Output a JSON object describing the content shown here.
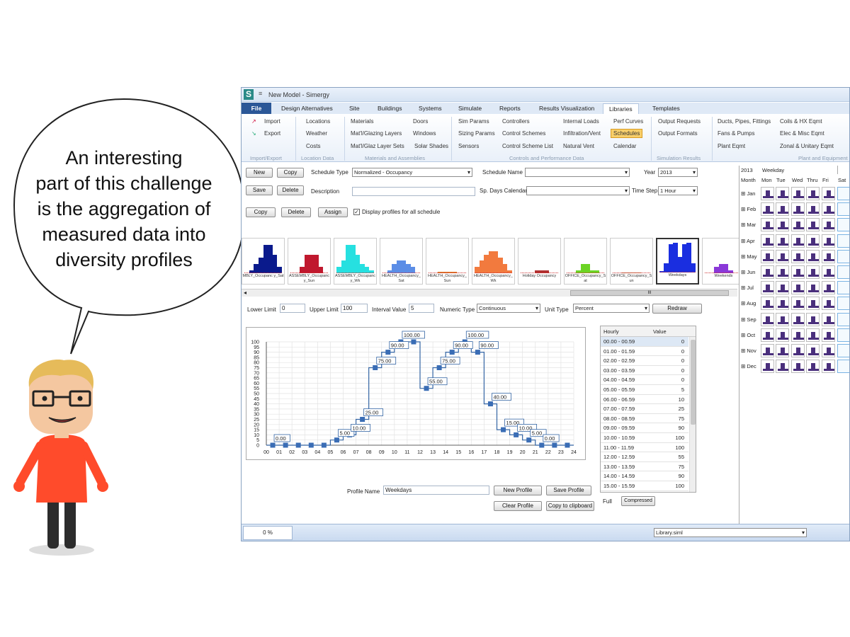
{
  "bubble_text": [
    "An interesting",
    "part of this challenge",
    "is the aggregation of",
    "measured data into",
    "diversity profiles"
  ],
  "window": {
    "title": "New Model - Simergy",
    "tabs": [
      "File",
      "Design Alternatives",
      "Site",
      "Buildings",
      "Systems",
      "Simulate",
      "Reports",
      "Results Visualization",
      "Libraries",
      "Templates"
    ],
    "active_tab": "Libraries"
  },
  "ribbon": {
    "import": "Import",
    "export": "Export",
    "locations": "Locations",
    "weather": "Weather",
    "costs": "Costs",
    "materials": "Materials",
    "doors": "Doors",
    "glazing_layers": "Mat'l/Glazing Layers",
    "windows": "Windows",
    "glaz_layer_sets": "Mat'l/Glaz Layer Sets",
    "solar_shades": "Solar Shades",
    "sim_params": "Sim Params",
    "sizing_params": "Sizing Params",
    "sensors": "Sensors",
    "controllers": "Controllers",
    "control_schemes": "Control Schemes",
    "control_scheme_list": "Control Scheme List",
    "internal_loads": "Internal Loads",
    "infiltration_vent": "Infiltration/Vent",
    "natural_vent": "Natural Vent",
    "perf_curves": "Perf Curves",
    "schedules": "Schedules",
    "calendar": "Calendar",
    "output_requests": "Output Requests",
    "output_formats": "Output Formats",
    "ducts": "Ducts, Pipes, Fittings",
    "fans_pumps": "Fans & Pumps",
    "plant_eqmt": "Plant Eqmt",
    "coils": "Coils & HX Eqmt",
    "elec_misc": "Elec & Misc Eqmt",
    "zonal_unitary": "Zonal & Unitary Eqmt",
    "group_import_export": "Import/Export",
    "group_location": "Location Data",
    "group_materials": "Materials and Assemblies",
    "group_controls": "Controls and Performance Data",
    "group_sim_results": "Simulation Results",
    "group_plant": "Plant and Equipment"
  },
  "form": {
    "new": "New",
    "copy": "Copy",
    "save": "Save",
    "delete": "Delete",
    "schedule_type_label": "Schedule Type",
    "schedule_type": "Normalized - Occupancy",
    "schedule_name_label": "Schedule Name",
    "year_label": "Year",
    "year": "2013",
    "description_label": "Description",
    "sp_days_label": "Sp. Days Calendar",
    "time_step_label": "Time Step",
    "time_step": "1 Hour",
    "copy2": "Copy",
    "delete2": "Delete",
    "assign": "Assign",
    "display_all": "Display profiles for all schedule"
  },
  "thumbnails": [
    {
      "label": "MBLY_Occupanc y_Sat",
      "color": "#0a1a8c"
    },
    {
      "label": "ASSEMBLY_Occupanc y_Sun",
      "color": "#c0182e"
    },
    {
      "label": "ASSEMBLY_Occupanc y_Wk",
      "color": "#26e0e0"
    },
    {
      "label": "HEALTH_Occupancy_ Sat",
      "color": "#5b8de6"
    },
    {
      "label": "HEALTH_Occupancy_ Sun",
      "color": "#e07c2a"
    },
    {
      "label": "HEALTH_Occupancy_ Wk",
      "color": "#f27a3e"
    },
    {
      "label": "Holiday Occupancy",
      "color": "#b03030"
    },
    {
      "label": "OFFICE_Occupancy_S at",
      "color": "#6cd424"
    },
    {
      "label": "OFFICE_Occupancy_S un",
      "color": "#c07840"
    },
    {
      "label": "Weekdays",
      "color": "#1a2ee0"
    },
    {
      "label": "Weekends",
      "color": "#8a38d8"
    }
  ],
  "hscroll_label": "III",
  "limits": {
    "lower_label": "Lower Limit",
    "lower": "0",
    "upper_label": "Upper Limit",
    "upper": "100",
    "interval_label": "Interval Value",
    "interval": "5",
    "numeric_type_label": "Numeric Type",
    "numeric_type": "Continuous",
    "unit_type_label": "Unit Type",
    "unit_type": "Percent",
    "redraw": "Redraw"
  },
  "chart_data": {
    "type": "line",
    "x": [
      "00",
      "01",
      "02",
      "03",
      "04",
      "05",
      "06",
      "07",
      "08",
      "09",
      "10",
      "11",
      "12",
      "13",
      "14",
      "15",
      "16",
      "17",
      "18",
      "19",
      "20",
      "21",
      "22",
      "23",
      "24"
    ],
    "values": [
      0,
      0,
      0,
      0,
      0,
      5,
      10,
      25,
      75,
      90,
      100,
      100,
      55,
      75,
      90,
      100,
      90,
      40,
      15,
      10,
      5,
      0,
      0,
      0
    ],
    "labels": [
      "0.00",
      "5.00",
      "10.00",
      "25.00",
      "75.00",
      "90.00",
      "100.00",
      "55.00",
      "75.00",
      "90.00",
      "100.00",
      "90.00",
      "40.00",
      "15.00",
      "10.00",
      "5.00",
      "0.00"
    ],
    "yticks": [
      "100",
      "95",
      "90",
      "85",
      "80",
      "75",
      "70",
      "65",
      "60",
      "55",
      "50",
      "45",
      "40",
      "35",
      "30",
      "25",
      "20",
      "15",
      "10",
      "5",
      "0"
    ],
    "ylim": [
      0,
      100
    ]
  },
  "table": {
    "col_hourly": "Hourly",
    "col_value": "Value",
    "rows": [
      {
        "h": "00.00 - 00.59",
        "v": "0"
      },
      {
        "h": "01.00 - 01.59",
        "v": "0"
      },
      {
        "h": "02.00 - 02.59",
        "v": "0"
      },
      {
        "h": "03.00 - 03.59",
        "v": "0"
      },
      {
        "h": "04.00 - 04.59",
        "v": "0"
      },
      {
        "h": "05.00 - 05.59",
        "v": "5"
      },
      {
        "h": "06.00 - 06.59",
        "v": "10"
      },
      {
        "h": "07.00 - 07.59",
        "v": "25"
      },
      {
        "h": "08.00 - 08.59",
        "v": "75"
      },
      {
        "h": "09.00 - 09.59",
        "v": "90"
      },
      {
        "h": "10.00 - 10.59",
        "v": "100"
      },
      {
        "h": "11.00 - 11.59",
        "v": "100"
      },
      {
        "h": "12.00 - 12.59",
        "v": "55"
      },
      {
        "h": "13.00 - 13.59",
        "v": "75"
      },
      {
        "h": "14.00 - 14.59",
        "v": "90"
      },
      {
        "h": "15.00 - 15.59",
        "v": "100"
      }
    ],
    "tab_full": "Full",
    "tab_compressed": "Compressed"
  },
  "profile": {
    "name_label": "Profile Name",
    "name": "Weekdays",
    "new_profile": "New Profile",
    "save_profile": "Save Profile",
    "clear_profile": "Clear Profile",
    "copy_clipboard": "Copy to clipboard"
  },
  "calendar": {
    "year": "2013",
    "weekday": "Weekday",
    "month_col": "Month",
    "days": [
      "Mon",
      "Tue",
      "Wed",
      "Thru",
      "Fri",
      "Sat"
    ],
    "months": [
      "Jan",
      "Feb",
      "Mar",
      "Apr",
      "May",
      "Jun",
      "Jul",
      "Aug",
      "Sep",
      "Oct",
      "Nov",
      "Dec"
    ]
  },
  "status": {
    "progress": "0 %",
    "library": "Library.siml"
  }
}
